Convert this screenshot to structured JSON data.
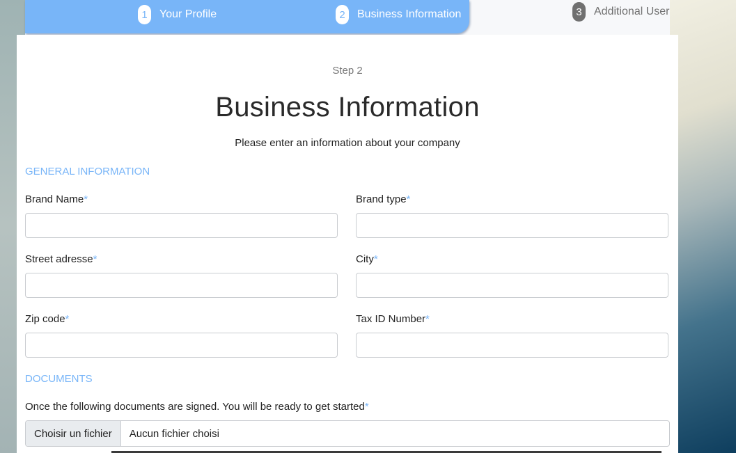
{
  "stepper": {
    "steps": [
      {
        "num": "1",
        "label": "Your Profile"
      },
      {
        "num": "2",
        "label": "Business Information"
      },
      {
        "num": "3",
        "label": "Additional User"
      }
    ]
  },
  "header": {
    "step_caption": "Step 2",
    "title": "Business Information",
    "subtitle": "Please enter an information about your company"
  },
  "general": {
    "section_title": "GENERAL INFORMATION",
    "required_mark": "*",
    "fields": [
      {
        "label": "Brand Name",
        "value": ""
      },
      {
        "label": "Brand type",
        "value": ""
      },
      {
        "label": "Street adresse",
        "value": ""
      },
      {
        "label": "City",
        "value": ""
      },
      {
        "label": "Zip code",
        "value": ""
      },
      {
        "label": "Tax ID Number",
        "value": ""
      }
    ]
  },
  "documents": {
    "section_title": "DOCUMENTS",
    "instruction": "Once the following documents are signed. You will be ready to get started",
    "file_button": "Choisir un fichier",
    "file_status": "Aucun fichier choisi"
  },
  "colors": {
    "accent": "#78b5f8",
    "pending": "#707070"
  }
}
